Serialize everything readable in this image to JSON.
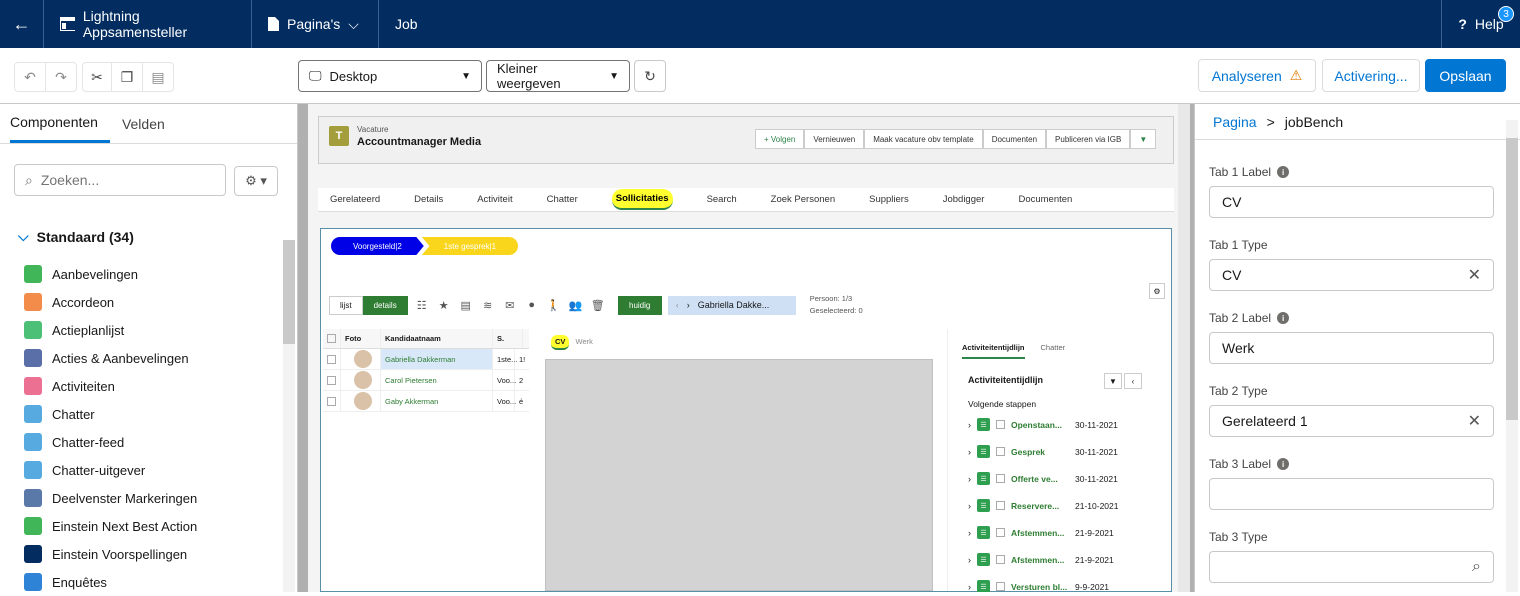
{
  "topbar": {
    "app_title": "Lightning Appsamensteller",
    "pages_label": "Pagina's",
    "object_label": "Job",
    "help_label": "Help",
    "help_badge": "3"
  },
  "toolbar": {
    "device_value": "Desktop",
    "view_value": "Kleiner weergeven",
    "analyze_label": "Analyseren",
    "activate_label": "Activering...",
    "save_label": "Opslaan"
  },
  "left": {
    "tabs": [
      "Componenten",
      "Velden"
    ],
    "search_placeholder": "Zoeken...",
    "section_title": "Standaard (34)",
    "components": [
      {
        "label": "Aanbevelingen",
        "color": "#41b658"
      },
      {
        "label": "Accordeon",
        "color": "#f38b4a"
      },
      {
        "label": "Actieplanlijst",
        "color": "#4bc076"
      },
      {
        "label": "Acties & Aanbevelingen",
        "color": "#5a6fa8"
      },
      {
        "label": "Activiteiten",
        "color": "#eb7092"
      },
      {
        "label": "Chatter",
        "color": "#56aadf"
      },
      {
        "label": "Chatter-feed",
        "color": "#56aadf"
      },
      {
        "label": "Chatter-uitgever",
        "color": "#56aadf"
      },
      {
        "label": "Deelvenster Markeringen",
        "color": "#5a78a8"
      },
      {
        "label": "Einstein Next Best Action",
        "color": "#41b658"
      },
      {
        "label": "Einstein Voorspellingen",
        "color": "#032d60"
      },
      {
        "label": "Enquêtes",
        "color": "#2e83d6"
      }
    ]
  },
  "canvas": {
    "header": {
      "subtitle": "Vacature",
      "title": "Accountmanager Media",
      "buttons": [
        "+ Volgen",
        "Vernieuwen",
        "Maak vacature obv template",
        "Documenten",
        "Publiceren via IGB"
      ]
    },
    "tabs": [
      "Gerelateerd",
      "Details",
      "Activiteit",
      "Chatter",
      "Sollicitaties",
      "Search",
      "Zoek Personen",
      "Suppliers",
      "Jobdigger",
      "Documenten"
    ],
    "path": [
      "Voorgesteld|2",
      "1ste gesprek|1"
    ],
    "actions": {
      "list": "lijst",
      "details": "details",
      "current": "huidig",
      "pager_name": "Gabriella Dakke...",
      "person_info": "Persoon: 1/3",
      "selected_info": "Geselecteerd: 0"
    },
    "grid": {
      "headers": [
        "Foto",
        "Kandidaatnaam",
        "S."
      ],
      "rows": [
        {
          "name": "Gabriella Dakkerman",
          "status": "1ste...",
          "num": "1!"
        },
        {
          "name": "Carol Pietersen",
          "status": "Voo...",
          "num": "2"
        },
        {
          "name": "Gaby Akkerman",
          "status": "Voo...",
          "num": "é"
        }
      ]
    },
    "mid_tabs": [
      "CV",
      "Werk"
    ],
    "timeline": {
      "tabs": [
        "Activiteitentijdlijn",
        "Chatter"
      ],
      "title": "Activiteitentijdlijn",
      "next_steps": "Volgende stappen",
      "items": [
        {
          "name": "Openstaan...",
          "date": "30-11-2021"
        },
        {
          "name": "Gesprek",
          "date": "30-11-2021"
        },
        {
          "name": "Offerte ve...",
          "date": "30-11-2021"
        },
        {
          "name": "Reservere...",
          "date": "21-10-2021"
        },
        {
          "name": "Afstemmen...",
          "date": "21-9-2021"
        },
        {
          "name": "Afstemmen...",
          "date": "21-9-2021"
        },
        {
          "name": "Versturen bl...",
          "date": "9-9-2021"
        }
      ]
    }
  },
  "right": {
    "crumb_root": "Pagina",
    "crumb_sep": ">",
    "crumb_current": "jobBench",
    "fields": [
      {
        "label": "Tab 1 Label",
        "value": "CV",
        "info": true
      },
      {
        "label": "Tab 1 Type",
        "value": "CV",
        "clear": true
      },
      {
        "label": "Tab 2 Label",
        "value": "Werk",
        "info": true
      },
      {
        "label": "Tab 2 Type",
        "value": "Gerelateerd 1",
        "clear": true
      },
      {
        "label": "Tab 3 Label",
        "value": "",
        "info": true
      },
      {
        "label": "Tab 3 Type",
        "value": "",
        "search": true
      }
    ]
  }
}
